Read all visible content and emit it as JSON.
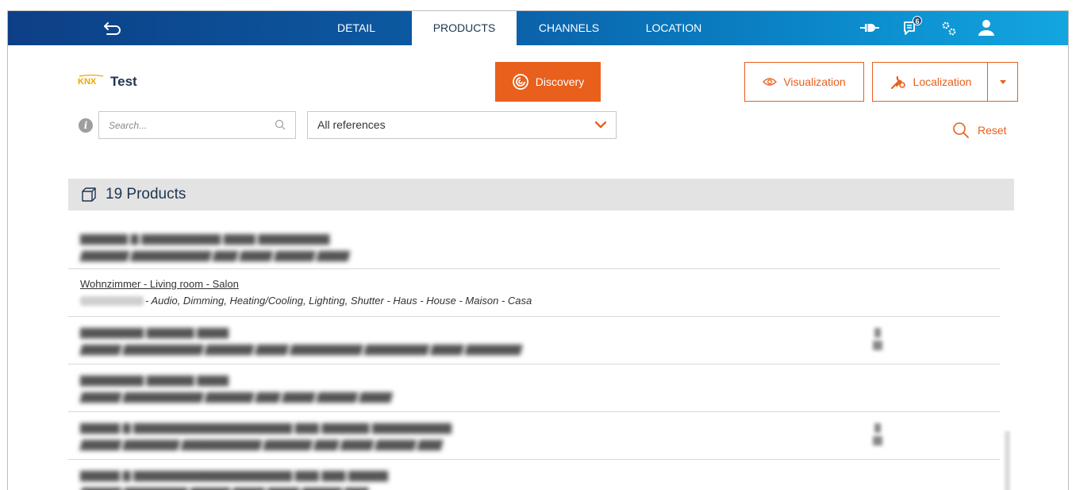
{
  "nav": {
    "tabs": [
      {
        "label": "DETAIL",
        "active": false
      },
      {
        "label": "PRODUCTS",
        "active": true
      },
      {
        "label": "CHANNELS",
        "active": false
      },
      {
        "label": "LOCATION",
        "active": false
      }
    ],
    "icons": [
      "back-icon",
      "connection-icon",
      "messages-icon",
      "settings-icon",
      "user-icon"
    ],
    "messages_badge": "6"
  },
  "header": {
    "logo_text": "KNX",
    "project_title": "Test",
    "discovery_label": "Discovery",
    "visualization_label": "Visualization",
    "localization_label": "Localization"
  },
  "filters": {
    "search_placeholder": "Search...",
    "reference_selected": "All references",
    "reset_label": "Reset"
  },
  "products": {
    "count_label": "19 Products",
    "visible_item": {
      "title": "Wohnzimmer - Living room - Salon",
      "subtitle": "- Audio, Dimming, Heating/Cooling, Lighting, Shutter - Haus - House - Maison - Casa"
    }
  },
  "colors": {
    "accent": "#e8601c",
    "nav_dark": "#0d3f86",
    "nav_light": "#13a6e0",
    "title": "#1f3550"
  }
}
